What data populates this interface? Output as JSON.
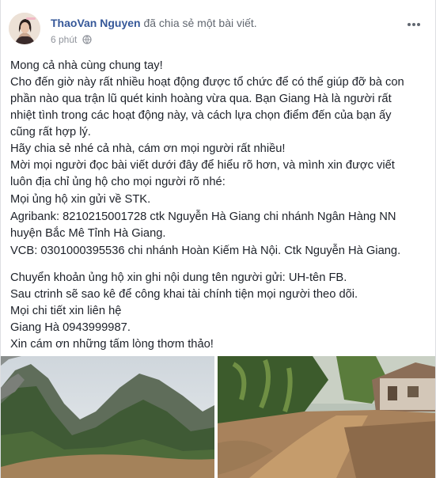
{
  "post": {
    "author_name": "ThaoVan Nguyen",
    "shared_text": "đã chia sẻ một bài viết.",
    "timestamp": "6 phút",
    "privacy_icon": "globe-icon",
    "more_icon": "ellipsis-icon",
    "lines": [
      "Mong cả nhà cùng chung tay!",
      "Cho đến giờ này rất nhiều hoạt động được tổ chức để có thể giúp đỡ bà con",
      "phần nào qua trận lũ quét kinh hoàng vừa qua. Bạn Giang Hà là người rất",
      "nhiệt tình trong các hoạt động này, và cách lựa chọn điểm đến của bạn ấy",
      "cũng rất hợp lý.",
      "Hãy chia sẻ nhé cả nhà, cám ơn mọi người rất nhiều!",
      "Mời mọi người đọc bài viết dưới đây để hiểu rõ hơn, và mình xin được viết",
      "luôn địa chỉ ủng hộ cho mọi người rõ nhé:",
      "Mọi ủng hộ xin gửi về STK.",
      "Agribank: 8210215001728 ctk Nguyễn Hà Giang chi nhánh Ngân Hàng NN",
      "huyện Bắc Mê Tỉnh Hà Giang.",
      "VCB: 0301000395536 chi nhánh Hoàn Kiếm Hà Nội. Ctk Nguyễn Hà Giang.",
      "Chuyển khoản ủng hộ xin ghi nội dung tên người gửi: UH-tên FB.",
      "Sau ctrinh sẽ sao kê để công khai tài chính tiện mọi người theo dõi.",
      "Mọi chi tiết xin liên hệ",
      "Giang Hà 0943999987.",
      "Xin cám ơn những tấm lòng thơm thảo!"
    ]
  },
  "colors": {
    "link": "#365899",
    "text": "#1d2129",
    "meta": "#90949c",
    "background": "#e9ebee"
  }
}
